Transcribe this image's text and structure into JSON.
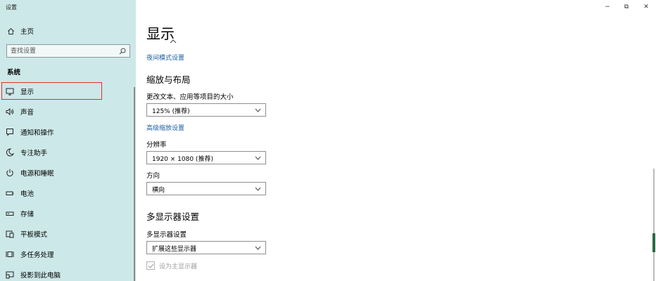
{
  "window": {
    "title": "设置",
    "controls": {
      "minimize": "−",
      "maximize": "⧉",
      "close": "✕"
    }
  },
  "sidebar": {
    "home_label": "主页",
    "search_placeholder": "查找设置",
    "section_label": "系统",
    "items": [
      {
        "label": "显示",
        "icon": "monitor-icon",
        "selected": true
      },
      {
        "label": "声音",
        "icon": "speaker-icon"
      },
      {
        "label": "通知和操作",
        "icon": "notification-icon"
      },
      {
        "label": "专注助手",
        "icon": "moon-icon"
      },
      {
        "label": "电源和睡眠",
        "icon": "power-icon"
      },
      {
        "label": "电池",
        "icon": "battery-icon"
      },
      {
        "label": "存储",
        "icon": "storage-icon"
      },
      {
        "label": "平板模式",
        "icon": "tablet-icon"
      },
      {
        "label": "多任务处理",
        "icon": "multitask-icon"
      },
      {
        "label": "投影到此电脑",
        "icon": "projection-icon"
      }
    ]
  },
  "main": {
    "title": "显示",
    "night_light_link": "夜间模式设置",
    "scale_section": {
      "heading": "缩放与布局",
      "text_size_label": "更改文本、应用等项目的大小",
      "text_size_value": "125% (推荐)",
      "advanced_scaling_link": "高级缩放设置",
      "resolution_label": "分辨率",
      "resolution_value": "1920 × 1080 (推荐)",
      "orientation_label": "方向",
      "orientation_value": "横向"
    },
    "multi_display": {
      "heading": "多显示器设置",
      "label": "多显示器设置",
      "value": "扩展这些显示器",
      "primary_checkbox_label": "设为主显示器",
      "primary_checked": true,
      "primary_disabled": true
    }
  },
  "colors": {
    "sidebar_bg": "#cde8e8",
    "accent_link": "#1a5fa8",
    "selection_outline": "#e03030"
  }
}
